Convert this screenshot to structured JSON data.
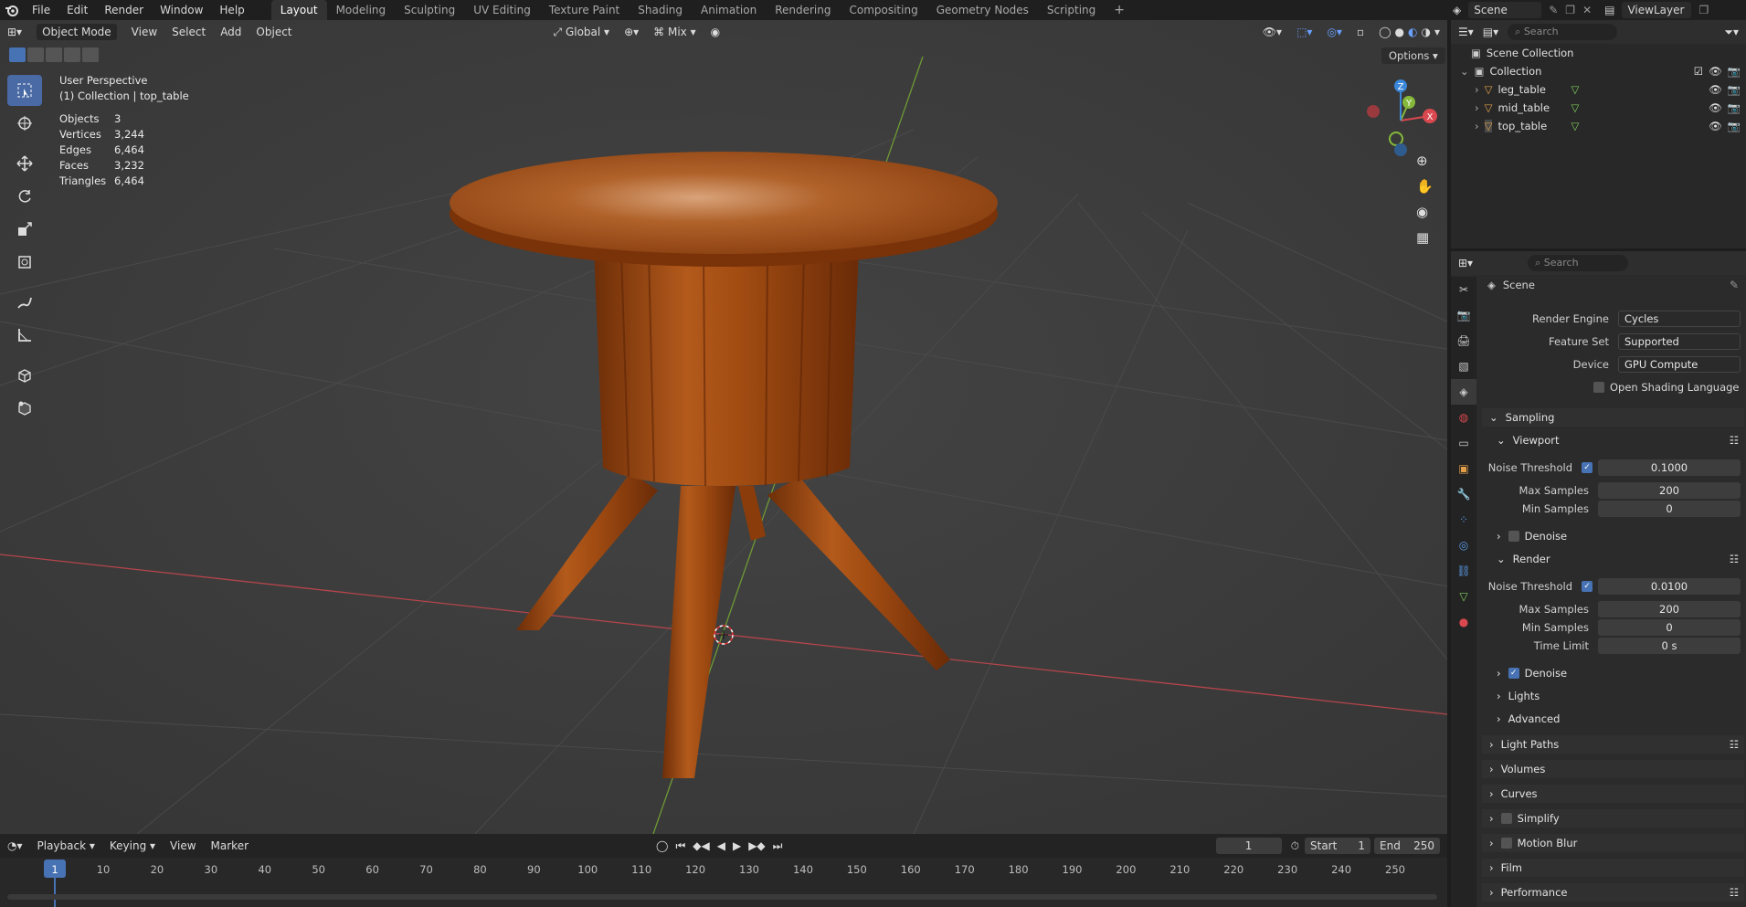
{
  "menu": [
    "File",
    "Edit",
    "Render",
    "Window",
    "Help"
  ],
  "workspaces": [
    "Layout",
    "Modeling",
    "Sculpting",
    "UV Editing",
    "Texture Paint",
    "Shading",
    "Animation",
    "Rendering",
    "Compositing",
    "Geometry Nodes",
    "Scripting"
  ],
  "active_workspace": "Layout",
  "top_right": {
    "scene": "Scene",
    "view_layer": "ViewLayer"
  },
  "viewport_header": {
    "mode": "Object Mode",
    "view": "View",
    "select": "Select",
    "add": "Add",
    "object": "Object",
    "transform": "Global",
    "snap_mode": "Mix",
    "options": "Options"
  },
  "overlay": {
    "perspective": "User Perspective",
    "collection": "(1) Collection | top_table",
    "stats": [
      {
        "k": "Objects",
        "v": "3"
      },
      {
        "k": "Vertices",
        "v": "3,244"
      },
      {
        "k": "Edges",
        "v": "6,464"
      },
      {
        "k": "Faces",
        "v": "3,232"
      },
      {
        "k": "Triangles",
        "v": "6,464"
      }
    ]
  },
  "gizmo": {
    "x": "X",
    "y": "Y",
    "z": "Z"
  },
  "outliner": {
    "search_placeholder": "Search",
    "scene_collection": "Scene Collection",
    "collection": "Collection",
    "objects": [
      "leg_table",
      "mid_table",
      "top_table"
    ]
  },
  "properties": {
    "search_placeholder": "Search",
    "context": "Scene",
    "render_engine": {
      "label": "Render Engine",
      "value": "Cycles"
    },
    "feature_set": {
      "label": "Feature Set",
      "value": "Supported"
    },
    "device": {
      "label": "Device",
      "value": "GPU Compute"
    },
    "osl": "Open Shading Language",
    "sampling": "Sampling",
    "viewport": {
      "title": "Viewport",
      "noise_threshold": {
        "label": "Noise Threshold",
        "value": "0.1000"
      },
      "max_samples": {
        "label": "Max Samples",
        "value": "200"
      },
      "min_samples": {
        "label": "Min Samples",
        "value": "0"
      },
      "denoise": "Denoise"
    },
    "render": {
      "title": "Render",
      "noise_threshold": {
        "label": "Noise Threshold",
        "value": "0.0100"
      },
      "max_samples": {
        "label": "Max Samples",
        "value": "200"
      },
      "min_samples": {
        "label": "Min Samples",
        "value": "0"
      },
      "time_limit": {
        "label": "Time Limit",
        "value": "0 s"
      },
      "denoise": "Denoise"
    },
    "lights": "Lights",
    "advanced": "Advanced",
    "sections": [
      "Light Paths",
      "Volumes",
      "Curves",
      "Simplify",
      "Motion Blur",
      "Film",
      "Performance"
    ]
  },
  "timeline": {
    "playback": "Playback",
    "keying": "Keying",
    "view": "View",
    "marker": "Marker",
    "current_frame": "1",
    "start_label": "Start",
    "start": "1",
    "end_label": "End",
    "end": "250",
    "ticks": [
      "1",
      "10",
      "20",
      "30",
      "40",
      "50",
      "60",
      "70",
      "80",
      "90",
      "100",
      "110",
      "120",
      "130",
      "140",
      "150",
      "160",
      "170",
      "180",
      "190",
      "200",
      "210",
      "220",
      "230",
      "240",
      "250"
    ]
  },
  "colors": {
    "accent": "#4772b3",
    "x_axis": "#d9484f",
    "y_axis": "#85b83b",
    "z_axis": "#3b87d9",
    "wood": "#9c4a12"
  }
}
